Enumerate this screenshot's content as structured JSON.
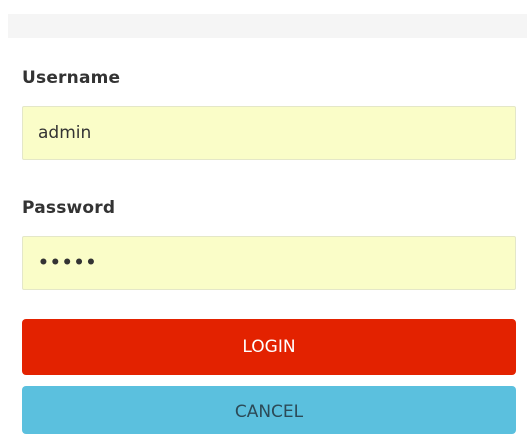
{
  "form": {
    "username_label": "Username",
    "username_value": "admin",
    "password_label": "Password",
    "password_value": "•••••",
    "login_label": "LOGIN",
    "cancel_label": "CANCEL"
  },
  "colors": {
    "input_background": "#fafdc8",
    "login_button": "#e32200",
    "cancel_button": "#5bc0de"
  }
}
